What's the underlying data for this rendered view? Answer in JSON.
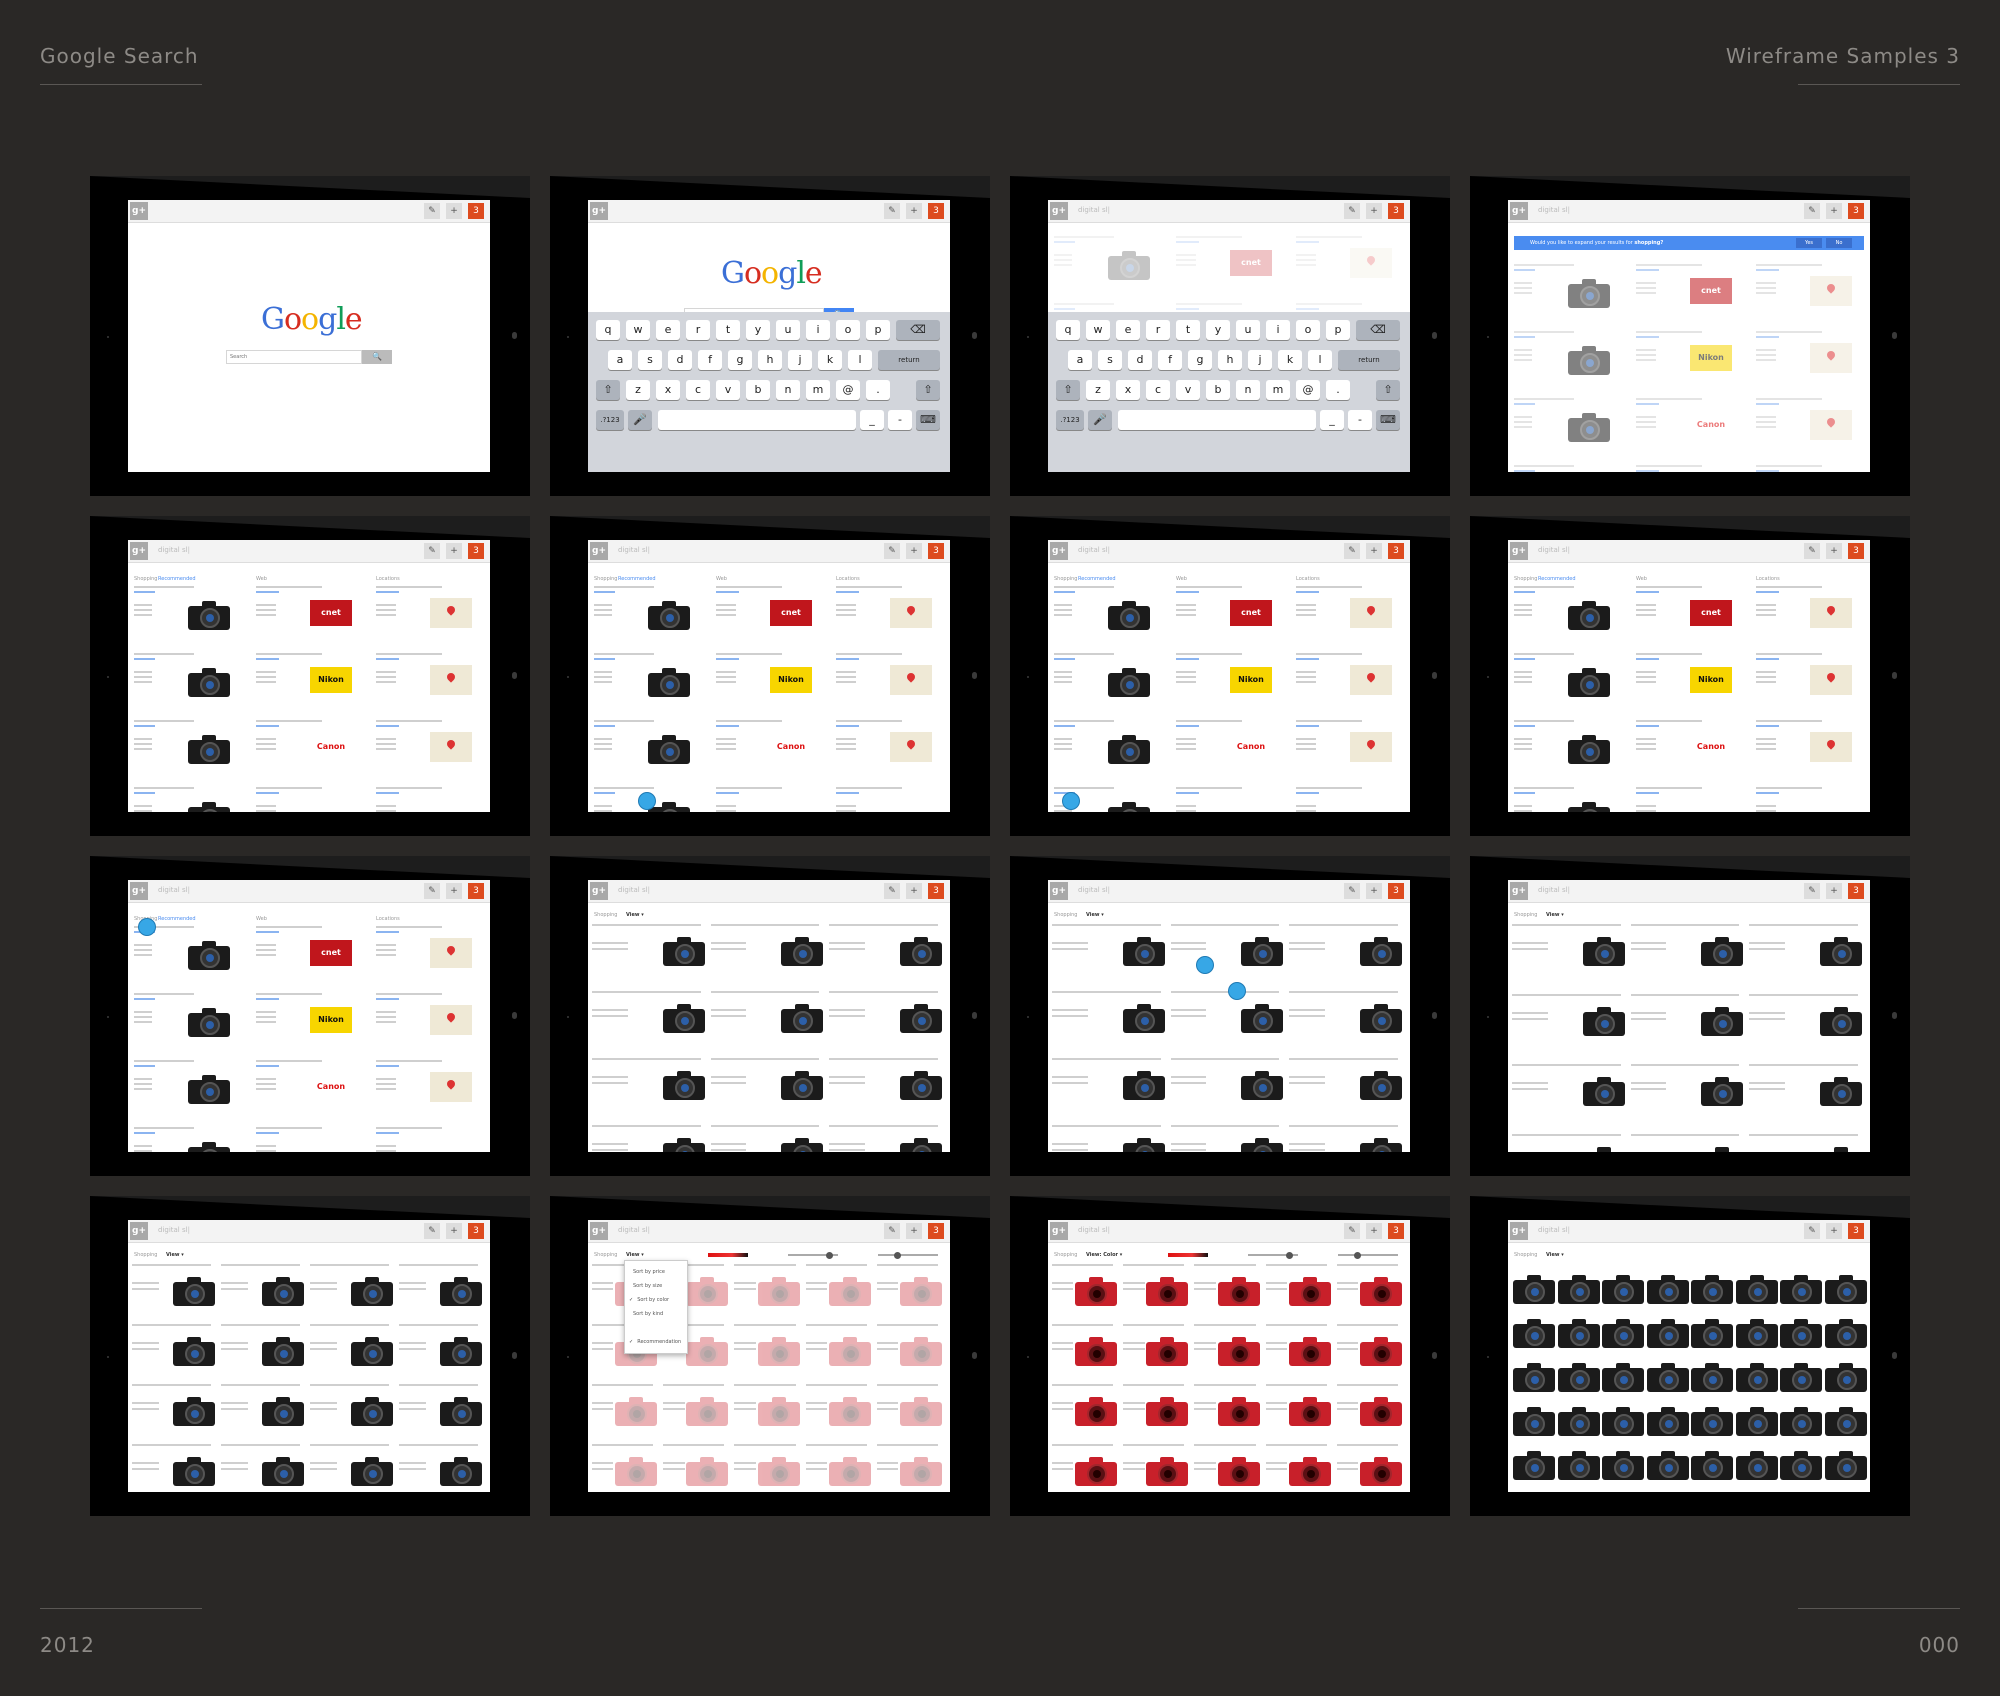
{
  "header": {
    "left_title": "Google Search",
    "right_title": "Wireframe Samples 3"
  },
  "footer": {
    "year": "2012",
    "page_number": "000"
  },
  "search": {
    "logo": "Google",
    "placeholder": "Search",
    "query": "digital sl|",
    "notif_count": "3"
  },
  "keyboard": {
    "row1": [
      "q",
      "w",
      "e",
      "r",
      "t",
      "y",
      "u",
      "i",
      "o",
      "p"
    ],
    "row2": [
      "a",
      "s",
      "d",
      "f",
      "g",
      "h",
      "j",
      "k",
      "l"
    ],
    "row3": [
      "z",
      "x",
      "c",
      "v",
      "b",
      "n",
      "m",
      "@",
      "."
    ],
    "return_label": "return",
    "numbers_label": ".?123"
  },
  "expand_prompt": {
    "text_prefix": "Would you like to expand your results for ",
    "text_bold": "shopping?",
    "yes": "Yes",
    "no": "No"
  },
  "sections": {
    "shopping": "Shopping",
    "recommended": "Recommended",
    "web": "Web",
    "locations": "Locations",
    "view": "View",
    "view_color": "View: Color"
  },
  "web_results": [
    "1. CNET Reviews | Digital SLR buying guide",
    "2. Nikon | Digital SLR Cameras",
    "3. Canon | Digital SLR Cameras",
    "4. B&H Photography Center"
  ],
  "location_results": [
    "A. WebsitePro Camera & Image",
    "B. J&R Music and Computer World",
    "C. Photo Tech Repair Services Inc",
    "D. Debbie's Camera Place"
  ],
  "shopping_results": [
    "1. Nikon D3100 Digital SLR Camera with...",
    "2. Canon EOS Rebel T3i Digital SLR/Reflection...",
    "3. Canon EOS Rebel T3 Digital SLR...",
    "4. Nikon D5100 Digital SLR Camera with..."
  ],
  "price_lines": [
    "$349 online",
    "$500 nearby"
  ],
  "brand_logos": [
    "cnet",
    "Nikon",
    "Canon"
  ],
  "sort_menu": [
    "Sort by price",
    "Sort by size",
    "Sort by color",
    "Sort by kind",
    "Recommendation"
  ],
  "colors": {
    "background": "#2a2826",
    "accent_blue": "#4285f4",
    "notif": "#dd4b1e",
    "touch_dot": "#37a7e6"
  },
  "icons": [
    "google-plus-icon",
    "pencil-icon",
    "plus-icon",
    "search-icon",
    "mic-icon",
    "camera-icon",
    "map-pin-icon"
  ]
}
